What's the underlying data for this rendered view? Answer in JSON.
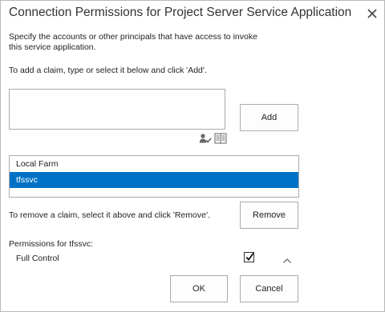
{
  "dialog": {
    "title": "Connection Permissions for Project Server Service Application",
    "close_icon": "close-icon"
  },
  "description": {
    "line1": "Specify the accounts or other principals that have access to invoke",
    "line2": "this service application."
  },
  "add_section": {
    "instruction": "To add a claim, type or select it below and click 'Add'.",
    "input_value": "",
    "add_label": "Add",
    "icons": [
      "check-names-icon",
      "browse-icon"
    ]
  },
  "claims": {
    "items": [
      "Local Farm",
      "tfssvc"
    ],
    "selected": "tfssvc",
    "selected_color": "#0072c6"
  },
  "remove_section": {
    "instruction": "To remove a claim, select it above and click 'Remove'.",
    "remove_label": "Remove"
  },
  "permissions": {
    "label": "Permissions for tfssvc:",
    "rows": [
      {
        "name": "Full Control",
        "checked": true
      }
    ]
  },
  "footer": {
    "ok_label": "OK",
    "cancel_label": "Cancel"
  }
}
